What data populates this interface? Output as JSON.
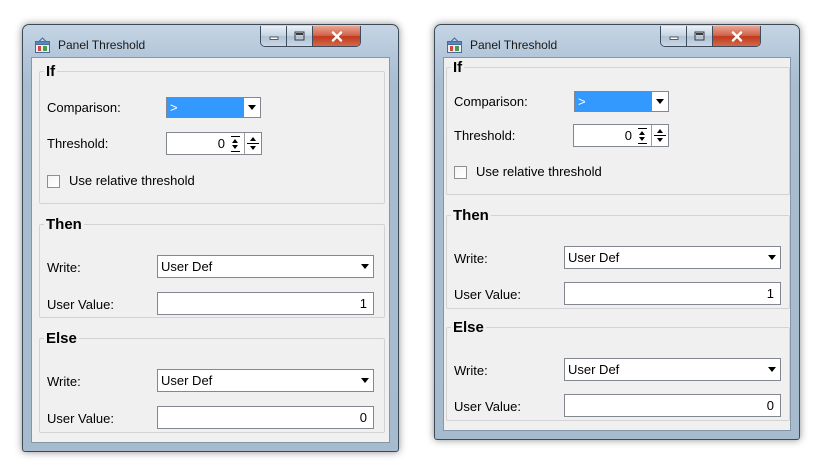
{
  "windows": [
    {
      "title": "Panel Threshold",
      "icon": "panel-app-icon",
      "if_group": {
        "legend": "If",
        "comparison_label": "Comparison:",
        "comparison_value": ">",
        "threshold_label": "Threshold:",
        "threshold_value": "0",
        "relative_label": "Use relative threshold",
        "relative_checked": false
      },
      "then_group": {
        "legend": "Then",
        "write_label": "Write:",
        "write_value": "User Def",
        "user_value_label": "User Value:",
        "user_value": "1"
      },
      "else_group": {
        "legend": "Else",
        "write_label": "Write:",
        "write_value": "User Def",
        "user_value_label": "User Value:",
        "user_value": "0"
      }
    },
    {
      "title": "Panel Threshold",
      "icon": "panel-app-icon",
      "if_group": {
        "legend": "If",
        "comparison_label": "Comparison:",
        "comparison_value": ">",
        "threshold_label": "Threshold:",
        "threshold_value": "0",
        "relative_label": "Use relative threshold",
        "relative_checked": false
      },
      "then_group": {
        "legend": "Then",
        "write_label": "Write:",
        "write_value": "User Def",
        "user_value_label": "User Value:",
        "user_value": "1"
      },
      "else_group": {
        "legend": "Else",
        "write_label": "Write:",
        "write_value": "User Def",
        "user_value_label": "User Value:",
        "user_value": "0"
      }
    }
  ],
  "colors": {
    "selection": "#3399ff",
    "close_button": "#c0391c",
    "frame": "#b4c7da",
    "client": "#f0f0f0"
  }
}
